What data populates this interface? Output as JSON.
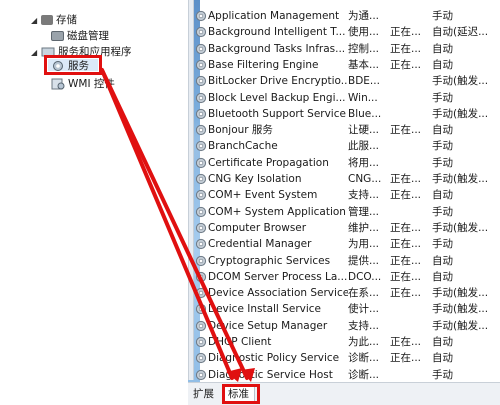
{
  "tree": {
    "storage": "存储",
    "disk_management": "磁盘管理",
    "services_apps": "服务和应用程序",
    "services": "服务",
    "wmi": "WMI 控件"
  },
  "services": [
    {
      "name": "Application Management",
      "desc": "为通...",
      "status": "",
      "startup": "手动"
    },
    {
      "name": "Background Intelligent T...",
      "desc": "使用...",
      "status": "正在...",
      "startup": "自动(延迟..."
    },
    {
      "name": "Background Tasks Infras...",
      "desc": "控制...",
      "status": "正在...",
      "startup": "自动"
    },
    {
      "name": "Base Filtering Engine",
      "desc": "基本...",
      "status": "正在...",
      "startup": "自动"
    },
    {
      "name": "BitLocker Drive Encryptio...",
      "desc": "BDE...",
      "status": "",
      "startup": "手动(触发..."
    },
    {
      "name": "Block Level Backup Engi...",
      "desc": "Win...",
      "status": "",
      "startup": "手动"
    },
    {
      "name": "Bluetooth Support Service",
      "desc": "Blue...",
      "status": "",
      "startup": "手动(触发..."
    },
    {
      "name": "Bonjour 服务",
      "desc": "让硬...",
      "status": "正在...",
      "startup": "自动"
    },
    {
      "name": "BranchCache",
      "desc": "此服...",
      "status": "",
      "startup": "手动"
    },
    {
      "name": "Certificate Propagation",
      "desc": "将用...",
      "status": "",
      "startup": "手动"
    },
    {
      "name": "CNG Key Isolation",
      "desc": "CNG...",
      "status": "正在...",
      "startup": "手动(触发..."
    },
    {
      "name": "COM+ Event System",
      "desc": "支持...",
      "status": "正在...",
      "startup": "自动"
    },
    {
      "name": "COM+ System Application",
      "desc": "管理...",
      "status": "",
      "startup": "手动"
    },
    {
      "name": "Computer Browser",
      "desc": "维护...",
      "status": "正在...",
      "startup": "手动(触发..."
    },
    {
      "name": "Credential Manager",
      "desc": "为用...",
      "status": "正在...",
      "startup": "手动"
    },
    {
      "name": "Cryptographic Services",
      "desc": "提供...",
      "status": "正在...",
      "startup": "自动"
    },
    {
      "name": "DCOM Server Process La...",
      "desc": "DCO...",
      "status": "正在...",
      "startup": "自动"
    },
    {
      "name": "Device Association Service",
      "desc": "在系...",
      "status": "正在...",
      "startup": "手动(触发..."
    },
    {
      "name": "Device Install Service",
      "desc": "使计...",
      "status": "",
      "startup": "手动(触发..."
    },
    {
      "name": "Device Setup Manager",
      "desc": "支持...",
      "status": "",
      "startup": "手动(触发..."
    },
    {
      "name": "DHCP Client",
      "desc": "为此...",
      "status": "正在...",
      "startup": "自动"
    },
    {
      "name": "Diagnostic Policy Service",
      "desc": "诊断...",
      "status": "正在...",
      "startup": "自动"
    },
    {
      "name": "Diagnostic Service Host",
      "desc": "诊断...",
      "status": "",
      "startup": "手动"
    }
  ],
  "tabs": {
    "extended": "扩展",
    "standard": "标准"
  },
  "colors": {
    "highlight": "#e01010",
    "accent": "#3b6fb0"
  }
}
